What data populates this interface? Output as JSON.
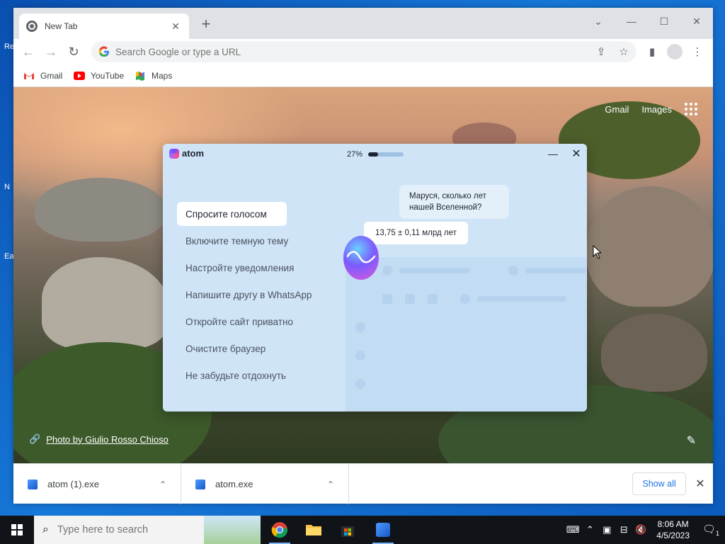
{
  "desktop": {
    "icon_labels": [
      "Re",
      "N",
      "Ea"
    ]
  },
  "browser": {
    "tab_title": "New Tab",
    "omnibox_placeholder": "Search Google or type a URL",
    "bookmarks": [
      {
        "label": "Gmail",
        "icon": "gmail-icon"
      },
      {
        "label": "YouTube",
        "icon": "youtube-icon"
      },
      {
        "label": "Maps",
        "icon": "maps-icon"
      }
    ]
  },
  "ntp": {
    "gmail_link": "Gmail",
    "images_link": "Images",
    "photo_credit": "Photo by Giulio Rosso Chioso"
  },
  "atom_dialog": {
    "brand": "atom",
    "progress_label": "27%",
    "progress_value": 0.27,
    "menu": [
      "Спросите голосом",
      "Включите темную тему",
      "Настройте уведомления",
      "Напишите другу в WhatsApp",
      "Откройте сайт приватно",
      "Очистите браузер",
      "Не забудьте отдохнуть"
    ],
    "question": "Маруся, сколько лет нашей Вселенной?",
    "answer": "13,75 ± 0,11 млрд лет"
  },
  "downloads": {
    "items": [
      {
        "name": "atom (1).exe"
      },
      {
        "name": "atom.exe"
      }
    ],
    "show_all": "Show all"
  },
  "taskbar": {
    "search_placeholder": "Type here to search",
    "time": "8:06 AM",
    "date": "4/5/2023",
    "notification_count": "1"
  },
  "colors": {
    "desktop": "#1e6fc8",
    "chrome_accent": "#1a73e8",
    "atom_panel": "#cfe4f7",
    "taskbar": "#101318"
  }
}
